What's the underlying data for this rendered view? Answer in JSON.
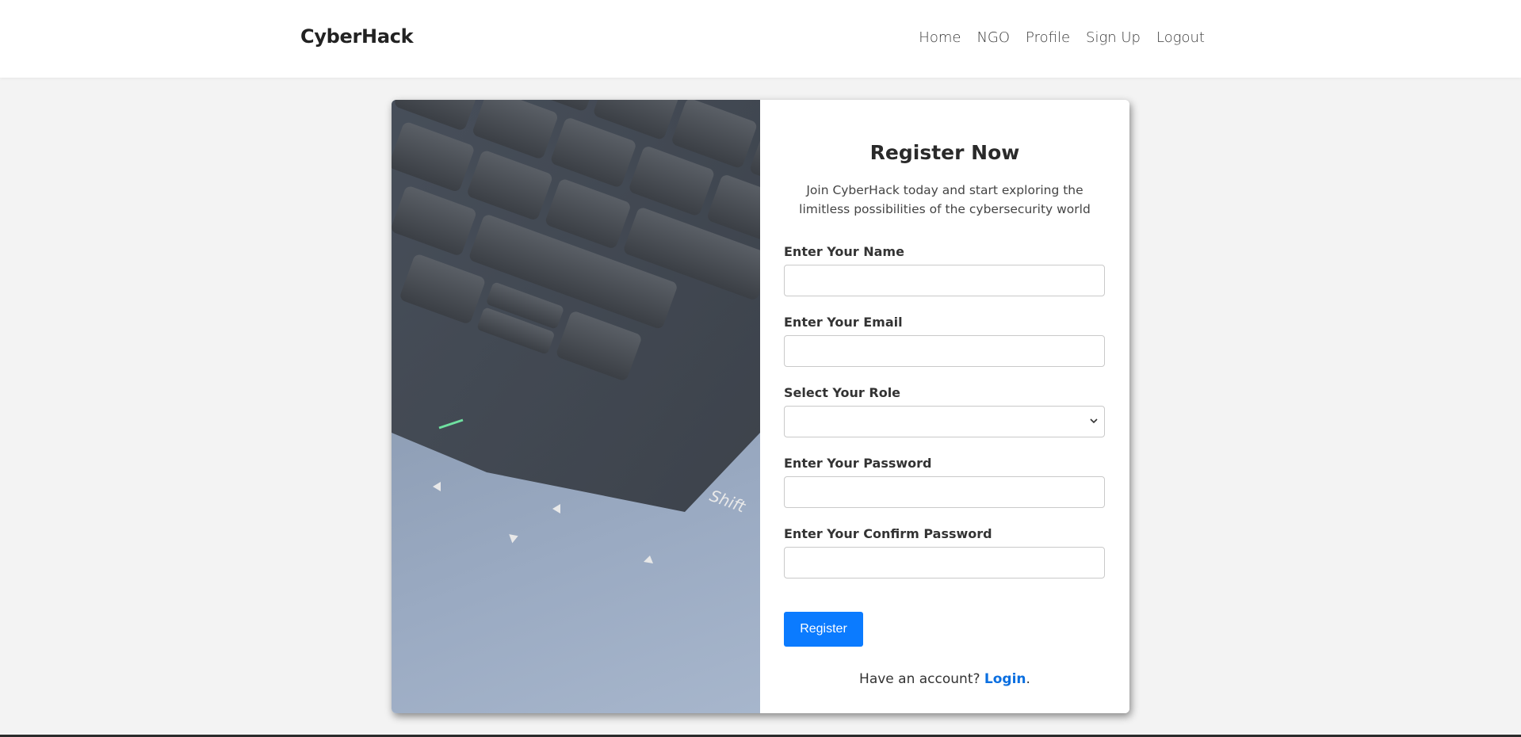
{
  "navbar": {
    "brand": "CyberHack",
    "links": [
      "Home",
      "NGO",
      "Profile",
      "Sign Up",
      "Logout"
    ]
  },
  "hero": {
    "image": "laptop-keyboard-photo",
    "key_label": "Shift"
  },
  "form": {
    "title": "Register Now",
    "subtitle": "Join CyberHack today and start exploring the limitless possibilities of the cybersecurity world",
    "fields": [
      {
        "label": "Enter Your Name",
        "value": "",
        "type": "text"
      },
      {
        "label": "Enter Your Email",
        "value": "",
        "type": "email"
      },
      {
        "label": "Select Your Role",
        "value": "",
        "type": "select"
      },
      {
        "label": "Enter Your Password",
        "value": "",
        "type": "password"
      },
      {
        "label": "Enter Your Confirm Password",
        "value": "",
        "type": "password"
      }
    ],
    "submit_label": "Register",
    "login_prompt": "Have an account?",
    "login_link": "Login",
    "login_suffix": "."
  },
  "colors": {
    "page_bg": "#f3f3f3",
    "accent": "#0b7bff",
    "link": "#0b6fe0"
  }
}
